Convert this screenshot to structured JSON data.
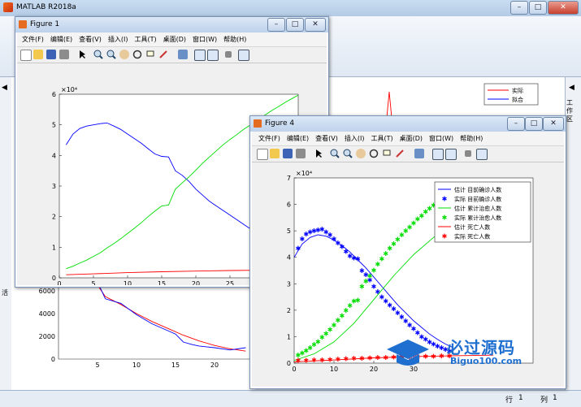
{
  "app": {
    "title": "MATLAB R2018a",
    "status_row_label": "行",
    "status_row": "1",
    "status_col_label": "列",
    "status_col": "1",
    "workspace_label": "工作区",
    "left_panel_char": "活"
  },
  "figure1": {
    "title": "Figure 1",
    "menu": [
      "文件(F)",
      "编辑(E)",
      "查看(V)",
      "插入(I)",
      "工具(T)",
      "桌面(D)",
      "窗口(W)",
      "帮助(H)"
    ]
  },
  "figure4": {
    "title": "Figure 4",
    "menu": [
      "文件(F)",
      "编辑(E)",
      "查看(V)",
      "插入(I)",
      "工具(T)",
      "桌面(D)",
      "窗口(W)",
      "帮助(H)"
    ]
  },
  "chart_data": [
    {
      "id": "figure1",
      "type": "line",
      "exponent_label": "×10⁴",
      "xlim": [
        0,
        35
      ],
      "ylim": [
        0,
        6
      ],
      "xticks": [
        0,
        5,
        10,
        15,
        20,
        25,
        30
      ],
      "yticks": [
        0,
        1,
        2,
        3,
        4,
        5,
        6
      ],
      "series": [
        {
          "color": "#0000ff",
          "x": [
            1,
            2,
            3,
            4,
            5,
            6,
            7,
            8,
            9,
            10,
            11,
            12,
            13,
            14,
            15,
            16,
            17,
            18,
            19,
            20,
            21,
            22,
            23,
            24,
            25,
            26,
            27,
            28,
            29,
            30,
            31,
            32
          ],
          "y": [
            4.35,
            4.7,
            4.88,
            4.96,
            5.0,
            5.04,
            5.06,
            4.96,
            4.85,
            4.7,
            4.55,
            4.4,
            4.22,
            4.05,
            3.97,
            3.95,
            3.5,
            3.35,
            3.15,
            2.9,
            2.7,
            2.5,
            2.35,
            2.2,
            2.05,
            1.9,
            1.75,
            1.6,
            1.45,
            1.3,
            1.15,
            1.0
          ]
        },
        {
          "color": "#00dd00",
          "x": [
            1,
            2,
            3,
            4,
            5,
            6,
            7,
            8,
            9,
            10,
            11,
            12,
            13,
            14,
            15,
            16,
            17,
            18,
            19,
            20,
            21,
            22,
            23,
            24,
            25,
            26,
            27,
            28,
            29,
            30,
            31,
            32,
            33,
            34,
            35
          ],
          "y": [
            0.3,
            0.38,
            0.48,
            0.58,
            0.7,
            0.82,
            0.98,
            1.12,
            1.28,
            1.45,
            1.62,
            1.8,
            2.0,
            2.18,
            2.35,
            2.38,
            2.9,
            3.1,
            3.3,
            3.52,
            3.75,
            3.95,
            4.15,
            4.35,
            4.52,
            4.68,
            4.85,
            5.0,
            5.15,
            5.3,
            5.45,
            5.58,
            5.72,
            5.85,
            5.97
          ]
        },
        {
          "color": "#ff0000",
          "x": [
            1,
            5,
            10,
            15,
            20,
            25,
            30,
            33
          ],
          "y": [
            0.1,
            0.13,
            0.17,
            0.2,
            0.22,
            0.24,
            0.25,
            0.26
          ]
        }
      ]
    },
    {
      "id": "background",
      "type": "line",
      "legend": [
        "实际",
        "拟合"
      ],
      "xticks": [
        5,
        10,
        15,
        20
      ],
      "yticks": [
        0,
        2000,
        4000,
        6000
      ],
      "ylim": [
        0,
        8000
      ],
      "series": [
        {
          "name": "实际",
          "color": "#ff0000",
          "x": [
            4,
            5,
            6,
            8,
            10,
            12,
            14,
            16,
            18,
            20,
            22,
            24
          ],
          "y": [
            7500,
            6500,
            5500,
            4800,
            4000,
            3300,
            2700,
            2100,
            1600,
            1200,
            900,
            700
          ]
        },
        {
          "name": "拟合",
          "color": "#0000ff",
          "x": [
            4,
            5,
            6,
            8,
            10,
            12,
            14,
            15,
            16,
            17,
            18,
            20,
            22,
            24
          ],
          "y": [
            8000,
            6800,
            5300,
            4900,
            3900,
            3100,
            2500,
            2200,
            1500,
            1300,
            1150,
            1000,
            800,
            1000
          ]
        }
      ]
    },
    {
      "id": "figure4",
      "type": "line",
      "exponent_label": "×10⁴",
      "xlim": [
        0,
        60
      ],
      "ylim": [
        0,
        7
      ],
      "xticks": [
        0,
        10,
        20,
        30
      ],
      "yticks": [
        0,
        1,
        2,
        3,
        4,
        5,
        6,
        7
      ],
      "legend": [
        "估计 目前确诊人数",
        "实际 目前确诊人数",
        "估计 累计治愈人数",
        "实际 累计治愈人数",
        "估计 死亡人数",
        "实际 死亡人数"
      ],
      "series": [
        {
          "name": "估计 目前确诊人数",
          "color": "#0000ff",
          "marker": "line",
          "x": [
            0,
            2,
            4,
            6,
            8,
            10,
            12,
            14,
            16,
            18,
            20,
            22,
            24,
            26,
            28,
            30,
            32,
            34,
            36,
            38,
            40
          ],
          "y": [
            4.0,
            4.5,
            4.75,
            4.85,
            4.8,
            4.65,
            4.45,
            4.2,
            3.9,
            3.6,
            3.25,
            2.9,
            2.55,
            2.2,
            1.9,
            1.6,
            1.35,
            1.1,
            0.9,
            0.72,
            0.58
          ]
        },
        {
          "name": "实际 目前确诊人数",
          "color": "#0000ff",
          "marker": "star",
          "x": [
            1,
            2,
            3,
            4,
            5,
            6,
            7,
            8,
            9,
            10,
            11,
            12,
            13,
            14,
            15,
            16,
            17,
            18,
            19,
            20,
            21,
            22,
            23,
            24,
            25,
            26,
            27,
            28,
            29,
            30,
            31,
            32,
            33,
            34,
            35,
            36,
            37,
            38,
            39
          ],
          "y": [
            4.35,
            4.7,
            4.88,
            4.96,
            5.0,
            5.04,
            5.06,
            4.96,
            4.85,
            4.7,
            4.55,
            4.4,
            4.22,
            4.05,
            3.97,
            3.95,
            3.5,
            3.35,
            3.15,
            2.9,
            2.7,
            2.5,
            2.35,
            2.2,
            2.05,
            1.9,
            1.75,
            1.6,
            1.45,
            1.3,
            1.15,
            1.0,
            0.9,
            0.8,
            0.72,
            0.65,
            0.58,
            0.52,
            0.46
          ]
        },
        {
          "name": "估计 累计治愈人数",
          "color": "#00dd00",
          "marker": "line",
          "x": [
            0,
            5,
            10,
            15,
            20,
            25,
            30,
            35,
            40,
            45,
            50
          ],
          "y": [
            0.1,
            0.35,
            0.8,
            1.5,
            2.4,
            3.3,
            4.1,
            4.75,
            5.25,
            5.6,
            5.85
          ]
        },
        {
          "name": "实际 累计治愈人数",
          "color": "#00dd00",
          "marker": "star",
          "x": [
            1,
            2,
            3,
            4,
            5,
            6,
            7,
            8,
            9,
            10,
            11,
            12,
            13,
            14,
            15,
            16,
            17,
            18,
            19,
            20,
            21,
            22,
            23,
            24,
            25,
            26,
            27,
            28,
            29,
            30,
            31,
            32,
            33,
            34,
            35,
            36,
            37,
            38,
            39,
            40,
            41,
            42,
            43,
            44,
            45,
            46,
            47,
            48
          ],
          "y": [
            0.3,
            0.38,
            0.48,
            0.58,
            0.7,
            0.82,
            0.98,
            1.12,
            1.28,
            1.45,
            1.62,
            1.8,
            2.0,
            2.18,
            2.35,
            2.38,
            2.9,
            3.1,
            3.3,
            3.52,
            3.75,
            3.95,
            4.15,
            4.35,
            4.52,
            4.68,
            4.85,
            5.0,
            5.15,
            5.3,
            5.45,
            5.58,
            5.72,
            5.85,
            5.97,
            6.05,
            6.12,
            6.18,
            6.24,
            6.3,
            6.34,
            6.38,
            6.42,
            6.45,
            6.48,
            6.5,
            6.52,
            6.54
          ]
        },
        {
          "name": "估计 死亡人数",
          "color": "#ff0000",
          "marker": "line",
          "x": [
            0,
            10,
            20,
            30,
            40,
            50
          ],
          "y": [
            0.05,
            0.12,
            0.2,
            0.25,
            0.28,
            0.3
          ]
        },
        {
          "name": "实际 死亡人数",
          "color": "#ff0000",
          "marker": "star",
          "x": [
            1,
            3,
            5,
            7,
            9,
            11,
            13,
            15,
            17,
            19,
            21,
            23,
            25,
            27,
            29,
            31,
            33,
            35,
            37,
            39
          ],
          "y": [
            0.1,
            0.11,
            0.12,
            0.13,
            0.14,
            0.15,
            0.17,
            0.18,
            0.19,
            0.2,
            0.21,
            0.22,
            0.23,
            0.24,
            0.25,
            0.25,
            0.26,
            0.26,
            0.27,
            0.27
          ]
        }
      ]
    }
  ],
  "watermark": {
    "text_main": "必过源码",
    "text_sub": "Biguo100.com"
  }
}
